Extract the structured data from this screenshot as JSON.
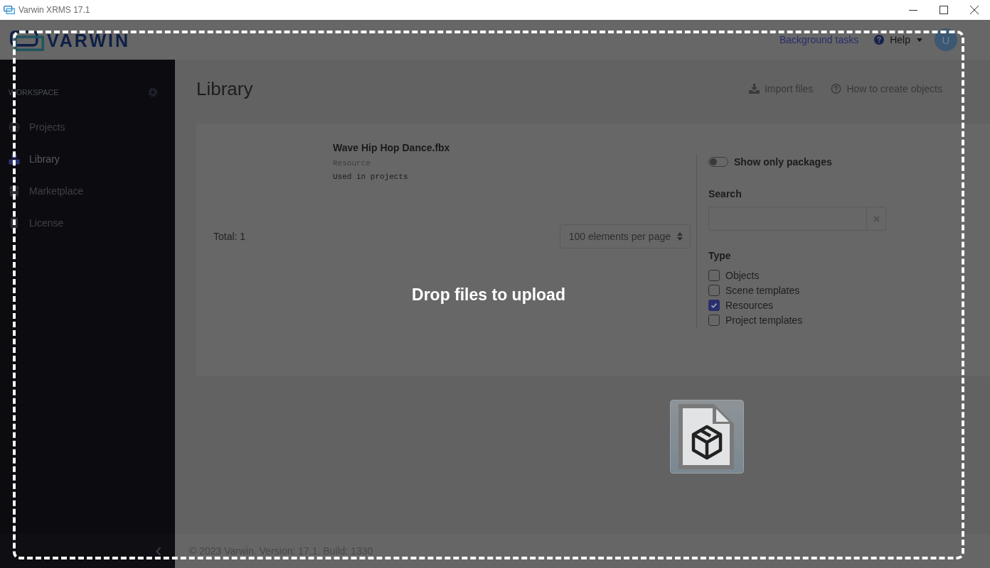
{
  "window": {
    "title": "Varwin XRMS 17.1"
  },
  "header": {
    "logo": "VARWIN",
    "background_tasks": "Background tasks",
    "help": "Help",
    "avatar": "U"
  },
  "sidebar": {
    "section": "WORKSPACE",
    "items": [
      {
        "label": "Projects",
        "selected": false
      },
      {
        "label": "Library",
        "selected": true
      },
      {
        "label": "Marketplace",
        "selected": false
      },
      {
        "label": "License",
        "selected": false
      }
    ]
  },
  "page": {
    "title": "Library",
    "actions": [
      "Import files",
      "How to create objects"
    ]
  },
  "assets": [
    {
      "name": "Wave Hip Hop Dance.fbx",
      "type": "Resource",
      "usage": "Used in projects"
    }
  ],
  "total": "Total: 1",
  "per_page": "100 elements per page",
  "filters": {
    "packages_toggle": {
      "label": "Show only packages",
      "on": false
    },
    "search": {
      "label": "Search"
    },
    "type": {
      "label": "Type",
      "options": [
        {
          "label": "Objects",
          "checked": false
        },
        {
          "label": "Scene templates",
          "checked": false
        },
        {
          "label": "Resources",
          "checked": true
        },
        {
          "label": "Project templates",
          "checked": false
        }
      ]
    }
  },
  "drop_overlay": {
    "text": "Drop files to upload"
  },
  "footer": "© 2023 Varwin. Version: 17.1. Build: 1330"
}
